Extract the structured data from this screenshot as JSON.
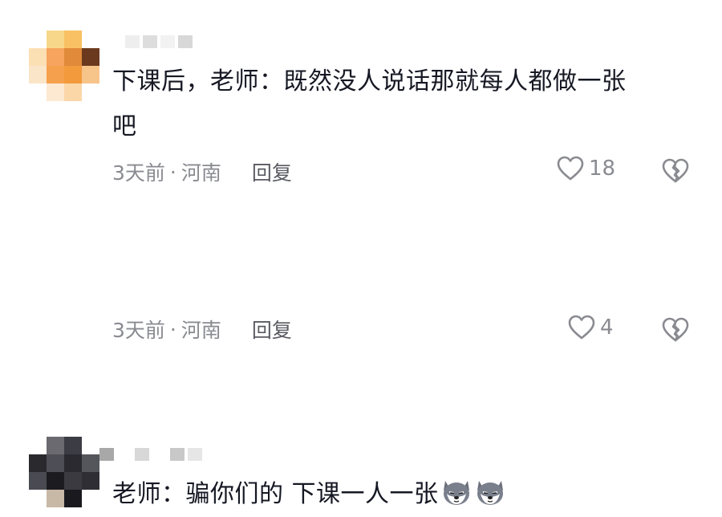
{
  "colors": {
    "text": "#161823",
    "meta": "#8a8b91",
    "icon": "#8a8b91"
  },
  "comments": [
    {
      "text_line1": "下课后，老师：既然没人说话那就每人都做一张",
      "text_line2": "吧",
      "time": "3天前",
      "dot": "·",
      "location": "河南",
      "reply": "回复",
      "likes": "18",
      "icons": [
        "heart-icon",
        "broken-heart-icon"
      ]
    },
    {
      "text": "老师：骗你们的 下课一人一张",
      "emoji": [
        "husky-emoji",
        "husky-emoji"
      ],
      "time": "3天前",
      "dot": "·",
      "location": "河南",
      "reply": "回复",
      "likes": "4",
      "icons": [
        "heart-icon",
        "broken-heart-icon"
      ]
    }
  ]
}
